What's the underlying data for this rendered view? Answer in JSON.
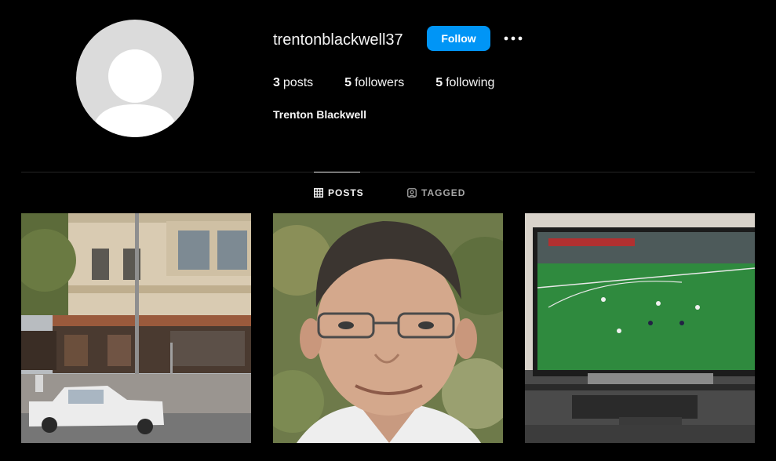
{
  "profile": {
    "username": "trentonblackwell37",
    "full_name": "Trenton Blackwell",
    "follow_label": "Follow",
    "stats": {
      "posts_count": "3",
      "posts_label": "posts",
      "followers_count": "5",
      "followers_label": "followers",
      "following_count": "5",
      "following_label": "following"
    }
  },
  "tabs": {
    "posts_label": "POSTS",
    "tagged_label": "TAGGED"
  },
  "posts": [
    {
      "subject": "street-building-photo"
    },
    {
      "subject": "man-portrait-photo"
    },
    {
      "subject": "tv-football-photo"
    }
  ],
  "colors": {
    "background": "#000000",
    "accent": "#0095f6",
    "divider": "#262626",
    "muted": "#a8a8a8"
  }
}
